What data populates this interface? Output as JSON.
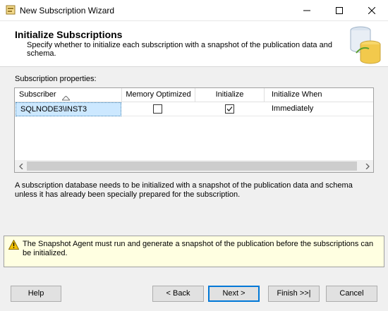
{
  "window": {
    "title": "New Subscription Wizard"
  },
  "header": {
    "title": "Initialize Subscriptions",
    "description": "Specify whether to initialize each subscription with a snapshot of the publication data and schema."
  },
  "section_label": "Subscription properties:",
  "grid": {
    "columns": [
      "Subscriber",
      "Memory Optimized",
      "Initialize",
      "Initialize When"
    ],
    "rows": [
      {
        "subscriber": "SQLNODE3\\INST3",
        "memory_optimized": false,
        "initialize": true,
        "initialize_when": "Immediately"
      }
    ]
  },
  "info_text": "A subscription database needs to be initialized with a snapshot of the publication data and schema unless it has already been specially prepared for the subscription.",
  "warning_text": "The Snapshot Agent must run and generate a snapshot of the publication before the subscriptions can be initialized.",
  "buttons": {
    "help": "Help",
    "back": "< Back",
    "next": "Next >",
    "finish": "Finish >>|",
    "cancel": "Cancel"
  },
  "icons": {
    "app": "wizard-icon",
    "header": "database-cylinder-icon",
    "warning": "warning-triangle-icon",
    "sort": "sort-ascending-icon"
  },
  "colors": {
    "selection": "#cce8ff",
    "default_button_border": "#0078d7",
    "warning_background": "#ffffe1"
  }
}
